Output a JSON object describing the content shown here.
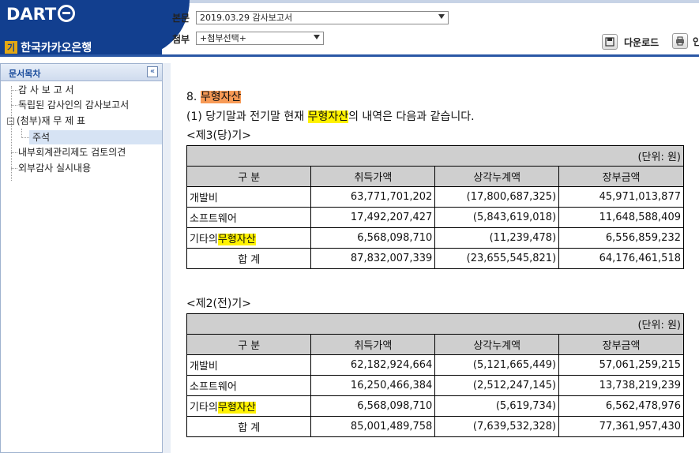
{
  "header": {
    "logo_text": "DART",
    "company_tag": "기",
    "company_name": "한국카카오은행",
    "main_doc_label": "본문",
    "main_doc_value": "2019.03.29  감사보고서",
    "attach_label": "첨부",
    "attach_value": "+첨부선택+",
    "download_label": "다운로드",
    "print_label": "인"
  },
  "sidebar": {
    "title": "문서목차",
    "collapse_icon": "«",
    "items": [
      {
        "label": "감 사 보 고 서"
      },
      {
        "label": "독립된 감사인의 감사보고서"
      },
      {
        "label": "(첨부)재 무 제 표"
      },
      {
        "label": "주석"
      },
      {
        "label": "내부회계관리제도 검토의견"
      },
      {
        "label": "외부감사 실시내용"
      }
    ]
  },
  "content": {
    "section_prefix": "8. ",
    "section_title": "무형자산",
    "intro_before": "(1) 당기말과 전기말 현재 ",
    "intro_highlight": "무형자산",
    "intro_after": "의 내역은 다음과 같습니다.",
    "tables": [
      {
        "title": "<제3(당)기>",
        "unit": "(단위: 원)",
        "headers": [
          "구  분",
          "취득가액",
          "상각누계액",
          "장부금액"
        ],
        "rows": [
          {
            "label": "개발비",
            "highlight": "",
            "values": [
              "63,771,701,202",
              "(17,800,687,325)",
              "45,971,013,877"
            ]
          },
          {
            "label": "소프트웨어",
            "highlight": "",
            "values": [
              "17,492,207,427",
              "(5,843,619,018)",
              "11,648,588,409"
            ]
          },
          {
            "label": "기타의",
            "highlight": "무형자산",
            "values": [
              "6,568,098,710",
              "(11,239,478)",
              "6,556,859,232"
            ]
          }
        ],
        "total": {
          "label": "합  계",
          "values": [
            "87,832,007,339",
            "(23,655,545,821)",
            "64,176,461,518"
          ]
        }
      },
      {
        "title": "<제2(전)기>",
        "unit": "(단위: 원)",
        "headers": [
          "구  분",
          "취득가액",
          "상각누계액",
          "장부금액"
        ],
        "rows": [
          {
            "label": "개발비",
            "highlight": "",
            "values": [
              "62,182,924,664",
              "(5,121,665,449)",
              "57,061,259,215"
            ]
          },
          {
            "label": "소프트웨어",
            "highlight": "",
            "values": [
              "16,250,466,384",
              "(2,512,247,145)",
              "13,738,219,239"
            ]
          },
          {
            "label": "기타의",
            "highlight": "무형자산",
            "values": [
              "6,568,098,710",
              "(5,619,734)",
              "6,562,478,976"
            ]
          }
        ],
        "total": {
          "label": "합  계",
          "values": [
            "85,001,489,758",
            "(7,639,532,328)",
            "77,361,957,430"
          ]
        }
      }
    ]
  }
}
